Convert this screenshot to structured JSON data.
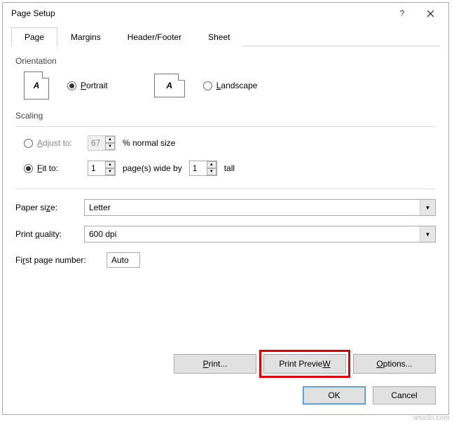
{
  "title": "Page Setup",
  "help": "?",
  "tabs": {
    "page": "Page",
    "margins": "Margins",
    "headerfooter": "Header/Footer",
    "sheet": "Sheet"
  },
  "orientation": {
    "label": "Orientation",
    "portrait": "Portrait",
    "portrait_u": "P",
    "landscape": "andscape",
    "landscape_u": "L",
    "glyph": "A"
  },
  "scaling": {
    "label": "Scaling",
    "adjust_pre": "djust to:",
    "adjust_u": "A",
    "adjust_value": "67",
    "adjust_suffix": "% normal size",
    "fit_pre": "it to:",
    "fit_u": "F",
    "fit_wide": "1",
    "fit_mid": "page(s) wide by",
    "fit_tall": "1",
    "fit_suffix": "tall"
  },
  "paper": {
    "label_pre": "Paper si",
    "label_u": "z",
    "label_post": "e:",
    "value": "Letter"
  },
  "quality": {
    "label_pre": "Print ",
    "label_u": "q",
    "label_post": "uality:",
    "value": "600 dpi"
  },
  "first": {
    "label_pre": "Fi",
    "label_u": "r",
    "label_post": "st page number:",
    "value": "Auto"
  },
  "buttons": {
    "print": "Print...",
    "preview": "Print Preview",
    "preview_u": "W",
    "options": "Options...",
    "options_u": "O",
    "ok": "OK",
    "cancel": "Cancel"
  },
  "watermark": "wsxdn.com"
}
